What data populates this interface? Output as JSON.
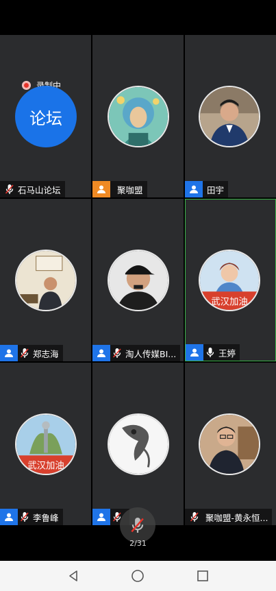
{
  "recording": {
    "label": "录制中"
  },
  "participants": [
    {
      "name": "石马山论坛",
      "role": "none",
      "mic": "muted",
      "avatar": "forum-circle",
      "avatar_text": "论坛"
    },
    {
      "name": "聚咖盟",
      "role": "orange",
      "mic": "none",
      "avatar": "illustration"
    },
    {
      "name": "田宇",
      "role": "blue",
      "mic": "none",
      "avatar": "man-suit"
    },
    {
      "name": "郑志海",
      "role": "blue",
      "mic": "muted",
      "avatar": "man-office"
    },
    {
      "name": "淘人传媒BI...",
      "role": "blue",
      "mic": "muted",
      "avatar": "man-cap"
    },
    {
      "name": "王婷",
      "role": "blue",
      "mic": "muted",
      "avatar": "woman",
      "active": true
    },
    {
      "name": "李鲁峰",
      "role": "blue",
      "mic": "muted",
      "avatar": "statue"
    },
    {
      "name": "",
      "role": "blue",
      "mic": "muted",
      "avatar": "ink"
    },
    {
      "name": "聚咖盟-黄永恒...",
      "role": "none",
      "mic": "muted",
      "avatar": "man-glasses"
    }
  ],
  "pager": {
    "text": "2/31"
  },
  "colors": {
    "role_blue": "#1f74e8",
    "role_orange": "#f08a24",
    "active_border": "#3bb54a",
    "tile_bg": "#2b2c2e"
  }
}
